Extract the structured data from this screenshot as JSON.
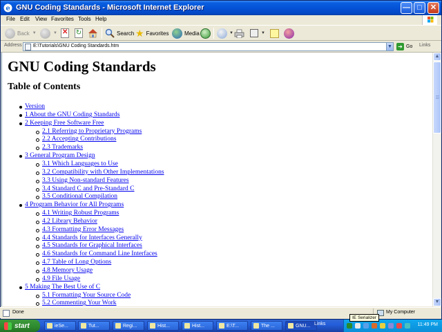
{
  "window": {
    "title": "GNU Coding Standards - Microsoft Internet Explorer"
  },
  "menu": {
    "file": "File",
    "edit": "Edit",
    "view": "View",
    "favorites": "Favorites",
    "tools": "Tools",
    "help": "Help"
  },
  "toolbar": {
    "back": "Back",
    "search": "Search",
    "favorites": "Favorites",
    "media": "Media"
  },
  "address": {
    "label": "Address",
    "value": "E:\\Tutorials\\GNU Coding Standards.htm",
    "go": "Go",
    "links": "Links"
  },
  "document": {
    "title": "GNU Coding Standards",
    "toc_title": "Table of Contents",
    "toc": [
      {
        "text": "Version",
        "level": 1
      },
      {
        "text": "1 About the GNU Coding Standards",
        "level": 1
      },
      {
        "text": "2 Keeping Free Software Free",
        "level": 1
      },
      {
        "text": "2.1 Referring to Proprietary Programs",
        "level": 2
      },
      {
        "text": "2.2 Accepting Contributions",
        "level": 2
      },
      {
        "text": "2.3 Trademarks",
        "level": 2
      },
      {
        "text": "3 General Program Design",
        "level": 1
      },
      {
        "text": "3.1 Which Languages to Use",
        "level": 2
      },
      {
        "text": "3.2 Compatibility with Other Implementations",
        "level": 2
      },
      {
        "text": "3.3 Using Non-standard Features",
        "level": 2
      },
      {
        "text": "3.4 Standard C and Pre-Standard C",
        "level": 2
      },
      {
        "text": "3.5 Conditional Compilation",
        "level": 2
      },
      {
        "text": "4 Program Behavior for All Programs",
        "level": 1
      },
      {
        "text": "4.1 Writing Robust Programs",
        "level": 2
      },
      {
        "text": "4.2 Library Behavior",
        "level": 2
      },
      {
        "text": "4.3 Formatting Error Messages",
        "level": 2
      },
      {
        "text": "4.4 Standards for Interfaces Generally",
        "level": 2
      },
      {
        "text": "4.5 Standards for Graphical Interfaces",
        "level": 2
      },
      {
        "text": "4.6 Standards for Command Line Interfaces",
        "level": 2
      },
      {
        "text": "4.7 Table of Long Options",
        "level": 2
      },
      {
        "text": "4.8 Memory Usage",
        "level": 2
      },
      {
        "text": "4.9 File Usage",
        "level": 2
      },
      {
        "text": "5 Making The Best Use of C",
        "level": 1
      },
      {
        "text": "5.1 Formatting Your Source Code",
        "level": 2
      },
      {
        "text": "5.2 Commenting Your Work",
        "level": 2
      }
    ]
  },
  "status": {
    "text": "Done",
    "zone": "My Computer"
  },
  "taskbar": {
    "start": "start",
    "tasks": [
      "ieSe...",
      "Tut...",
      "Regi...",
      "Hist...",
      "Hist...",
      "E:\\T...",
      "The ...",
      "GNU..."
    ],
    "links": "Links",
    "tooltip": "IE Serializer",
    "clock": "11:49 PM"
  }
}
